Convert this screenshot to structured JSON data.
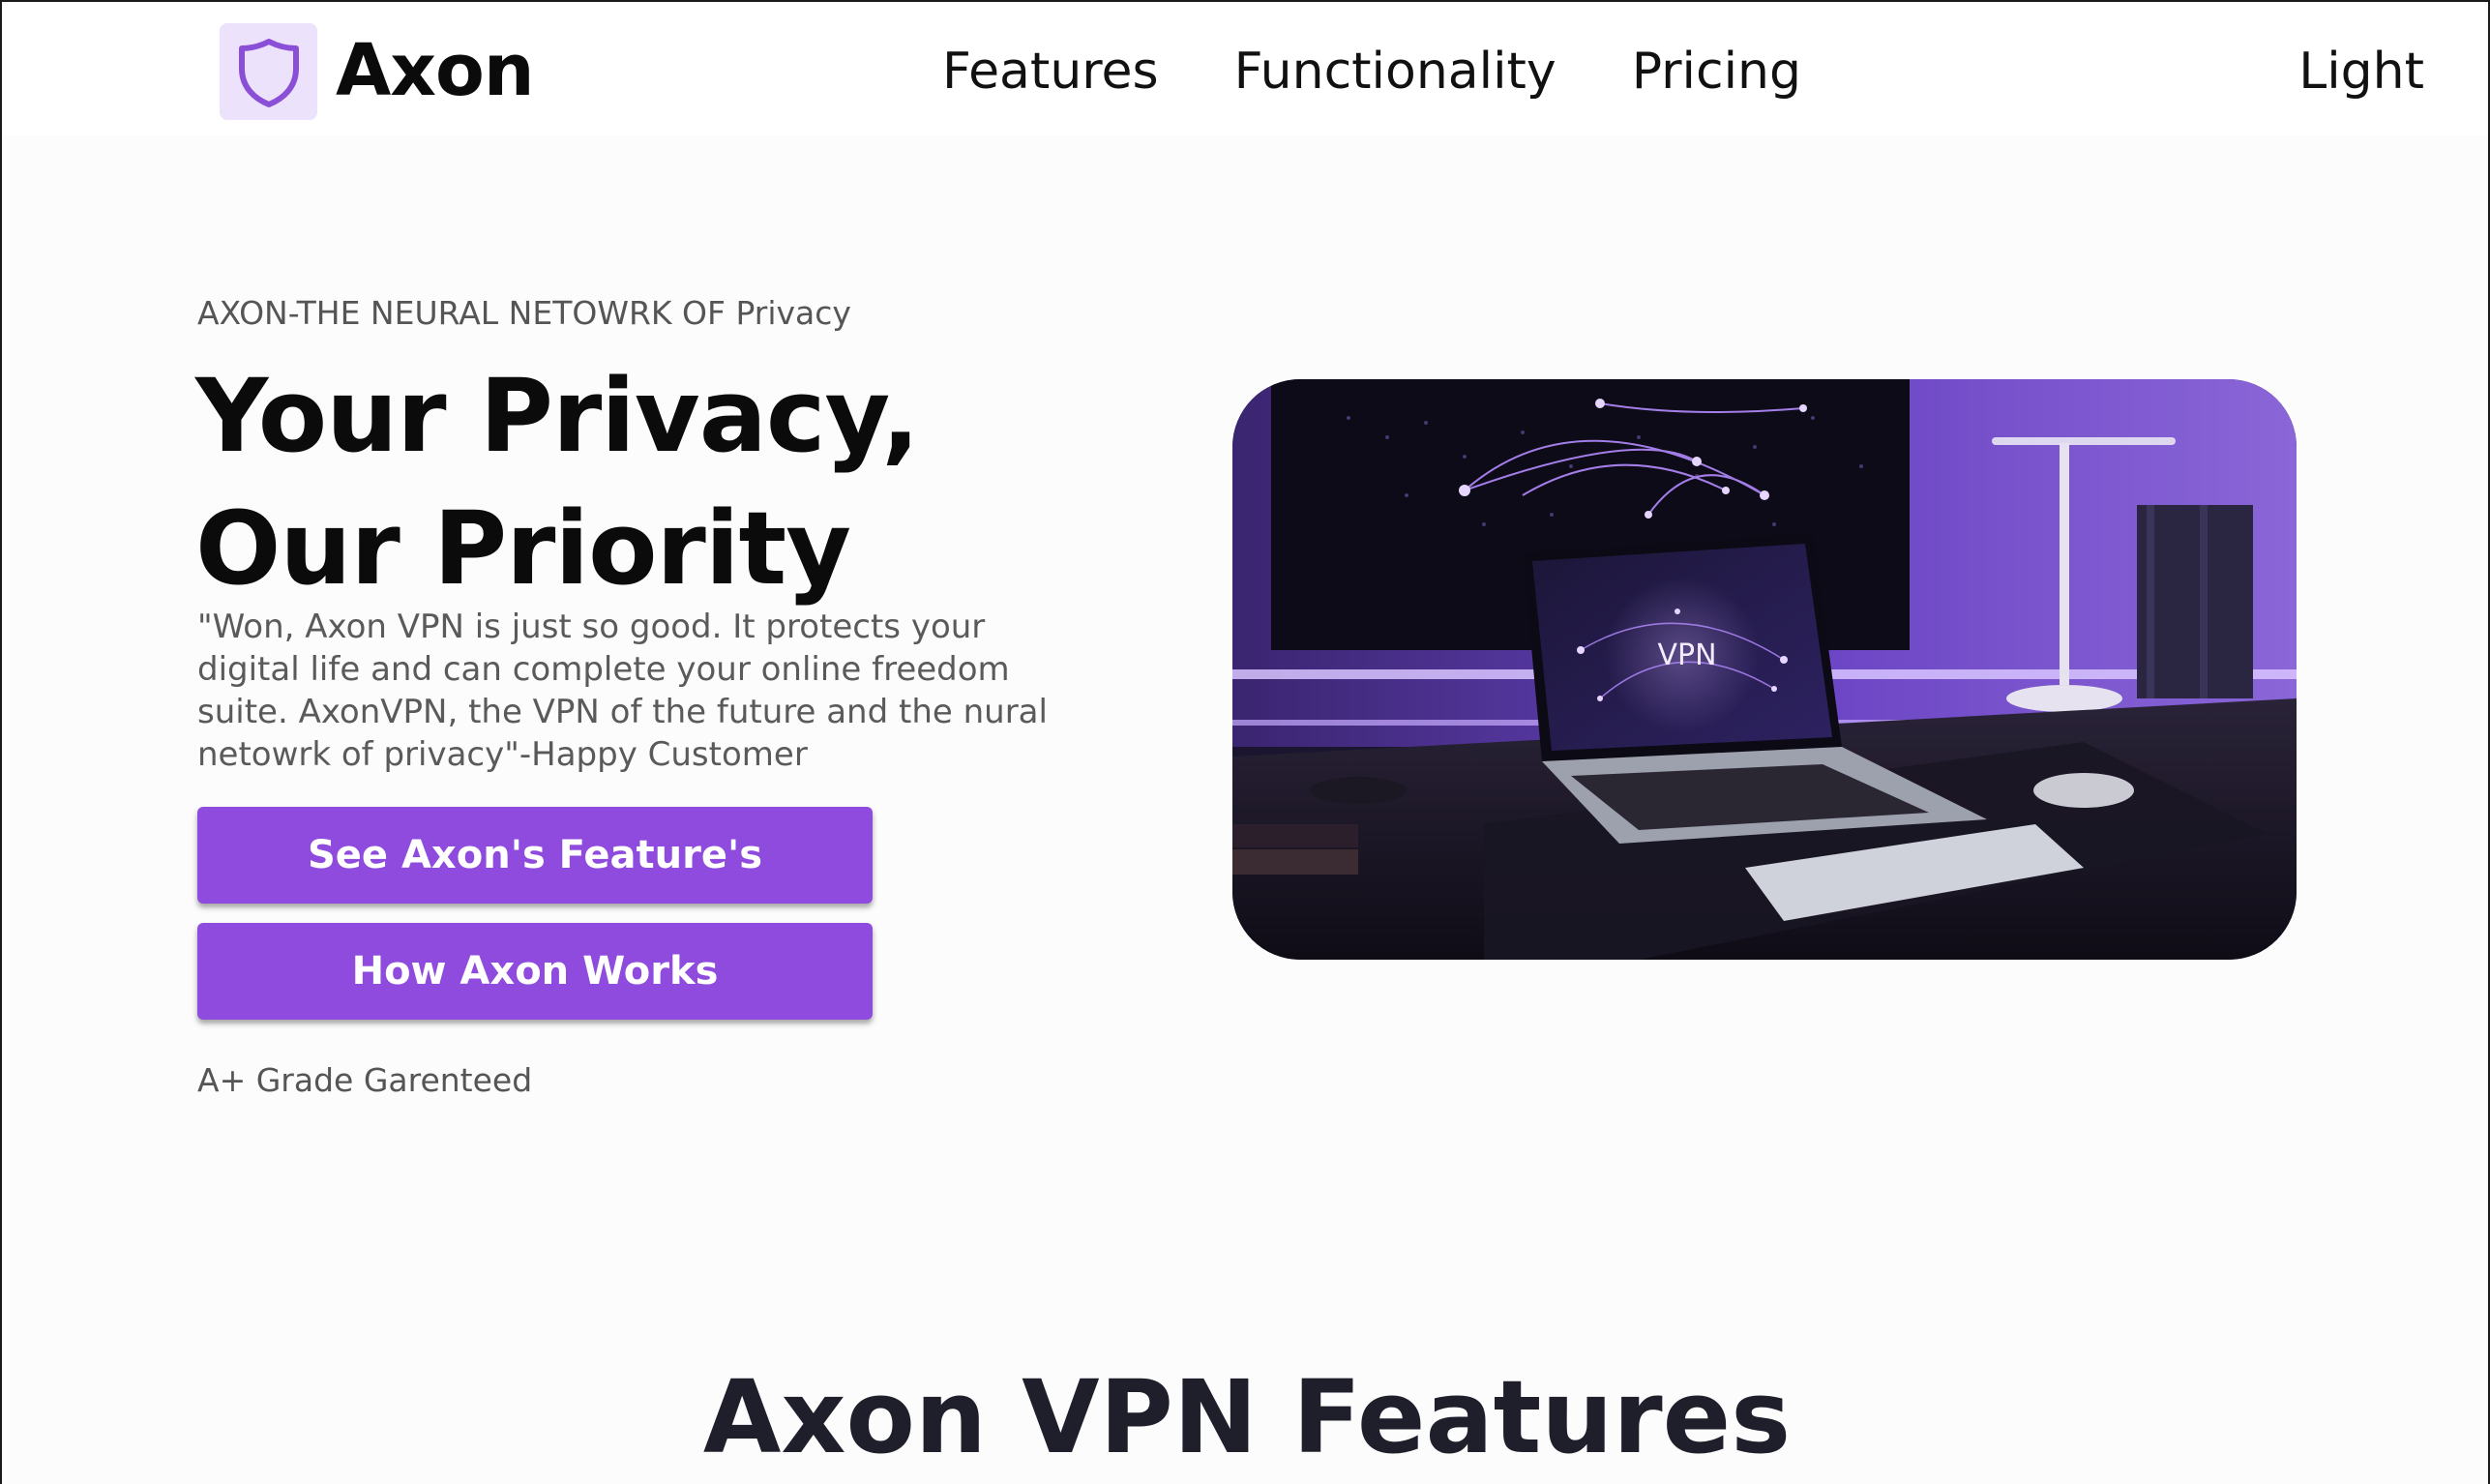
{
  "header": {
    "logo_icon": "shield-icon",
    "brand": "Axon",
    "nav": [
      {
        "label": "Features"
      },
      {
        "label": "Functionality"
      },
      {
        "label": "Pricing"
      }
    ],
    "theme_toggle": "Light"
  },
  "hero": {
    "eyebrow": "AXON-THE NEURAL NETOWRK OF Privacy",
    "title_line1": "Your Privacy,",
    "title_line2": "Our Priority",
    "quote": "\"Won, Axon VPN is just so good. It protects your digital life and can complete your online freedom suite. AxonVPN, the VPN of the future and the nural netowrk of privacy\"-Happy Customer",
    "primary_button": "See Axon's Feature's",
    "secondary_button": "How Axon Works",
    "grade": "A+ Grade Garenteed",
    "image": {
      "subject": "laptop-vpn-desk-image",
      "screen_text": "VPN"
    }
  },
  "features": {
    "title": "Axon VPN Features"
  },
  "colors": {
    "accent": "#8e4bde",
    "logo_bg": "#ece2fb",
    "logo_stroke": "#8a4fd6"
  }
}
